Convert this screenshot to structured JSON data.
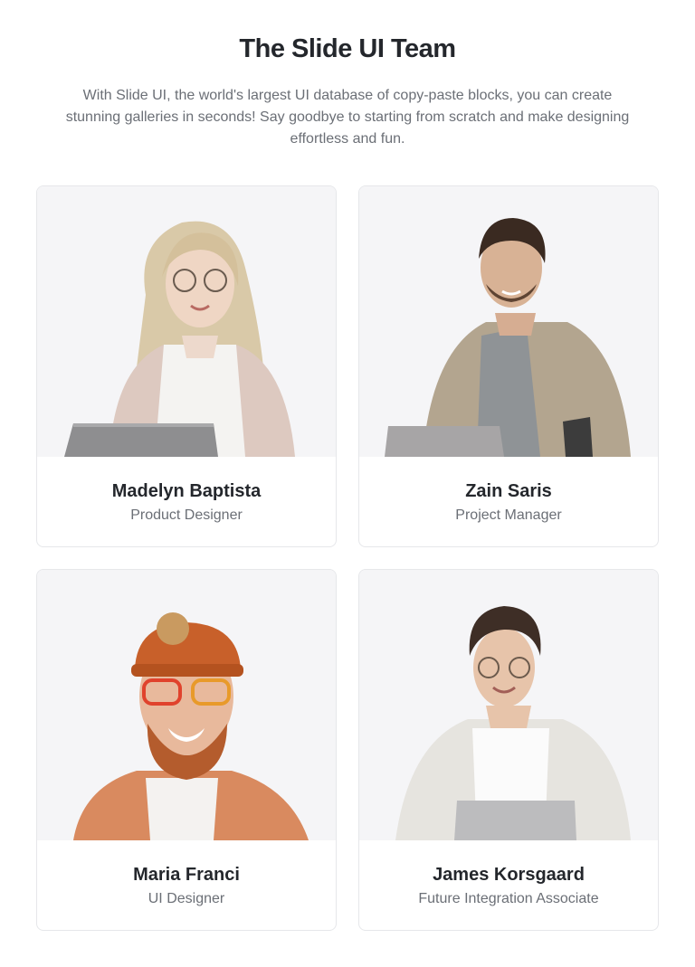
{
  "header": {
    "title": "The Slide UI Team",
    "description": "With Slide UI, the world's largest UI database of copy-paste blocks, you can create stunning galleries in seconds! Say goodbye to starting from scratch and make designing effortless and fun."
  },
  "team": [
    {
      "name": "Madelyn Baptista",
      "role": "Product Designer"
    },
    {
      "name": "Zain Saris",
      "role": "Project Manager"
    },
    {
      "name": "Maria Franci",
      "role": "UI Designer"
    },
    {
      "name": "James Korsgaard",
      "role": "Future Integration Associate"
    }
  ],
  "colors": {
    "photo_background": "#f5f5f7",
    "card_border": "#e6e7ea",
    "heading": "#24272c",
    "muted_text": "#6b6f76"
  }
}
